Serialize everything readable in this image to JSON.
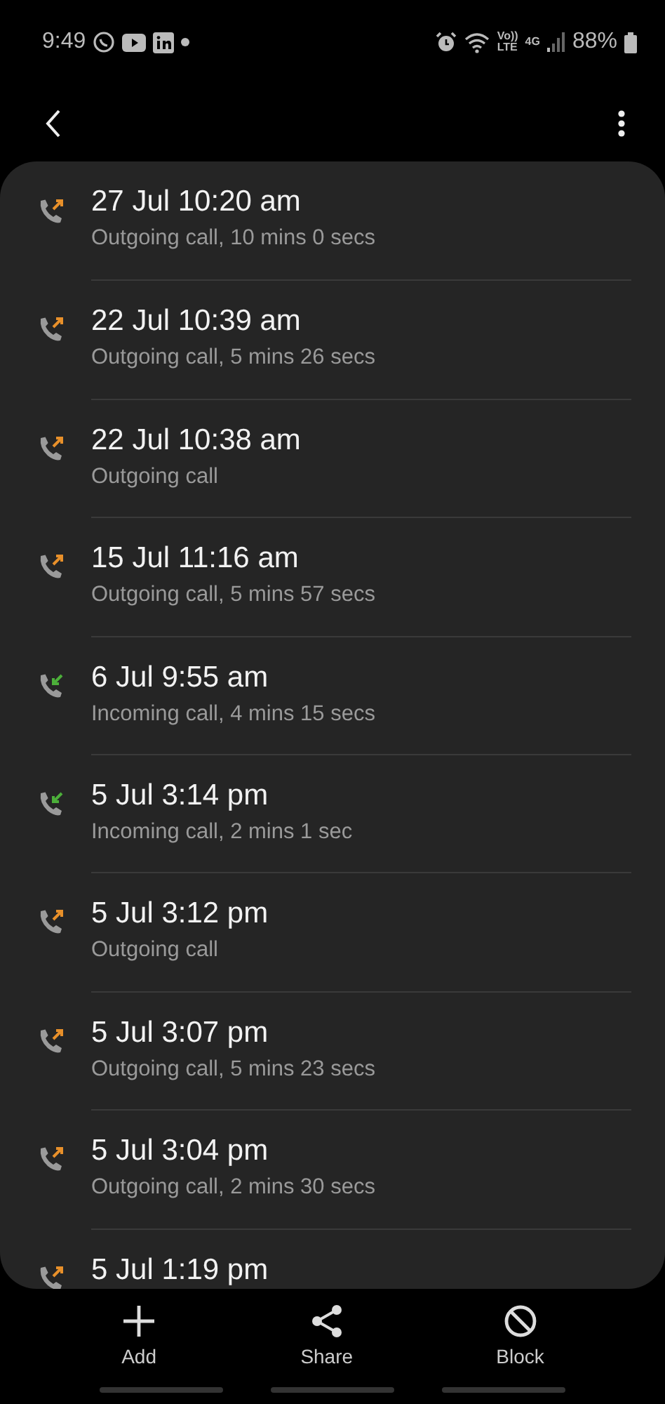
{
  "status_bar": {
    "time": "9:49",
    "volte": "Vo))",
    "lte": "LTE",
    "network": "4G",
    "battery": "88%"
  },
  "calls": [
    {
      "time": "27 Jul 10:20 am",
      "detail": "Outgoing call, 10 mins 0 secs",
      "kind": "outgoing"
    },
    {
      "time": "22 Jul 10:39 am",
      "detail": "Outgoing call, 5 mins 26 secs",
      "kind": "outgoing"
    },
    {
      "time": "22 Jul 10:38 am",
      "detail": "Outgoing call",
      "kind": "outgoing"
    },
    {
      "time": "15 Jul 11:16 am",
      "detail": "Outgoing call, 5 mins 57 secs",
      "kind": "outgoing"
    },
    {
      "time": "6 Jul 9:55 am",
      "detail": "Incoming call, 4 mins 15 secs",
      "kind": "incoming"
    },
    {
      "time": "5 Jul 3:14 pm",
      "detail": "Incoming call, 2 mins 1 sec",
      "kind": "incoming"
    },
    {
      "time": "5 Jul 3:12 pm",
      "detail": "Outgoing call",
      "kind": "outgoing"
    },
    {
      "time": "5 Jul 3:07 pm",
      "detail": "Outgoing call, 5 mins 23 secs",
      "kind": "outgoing"
    },
    {
      "time": "5 Jul 3:04 pm",
      "detail": "Outgoing call, 2 mins 30 secs",
      "kind": "outgoing"
    },
    {
      "time": "5 Jul 1:19 pm",
      "kind": "outgoing"
    }
  ],
  "actions": [
    {
      "label": "Add",
      "kind": "add"
    },
    {
      "label": "Share",
      "kind": "share"
    },
    {
      "label": "Block",
      "kind": "block"
    }
  ]
}
